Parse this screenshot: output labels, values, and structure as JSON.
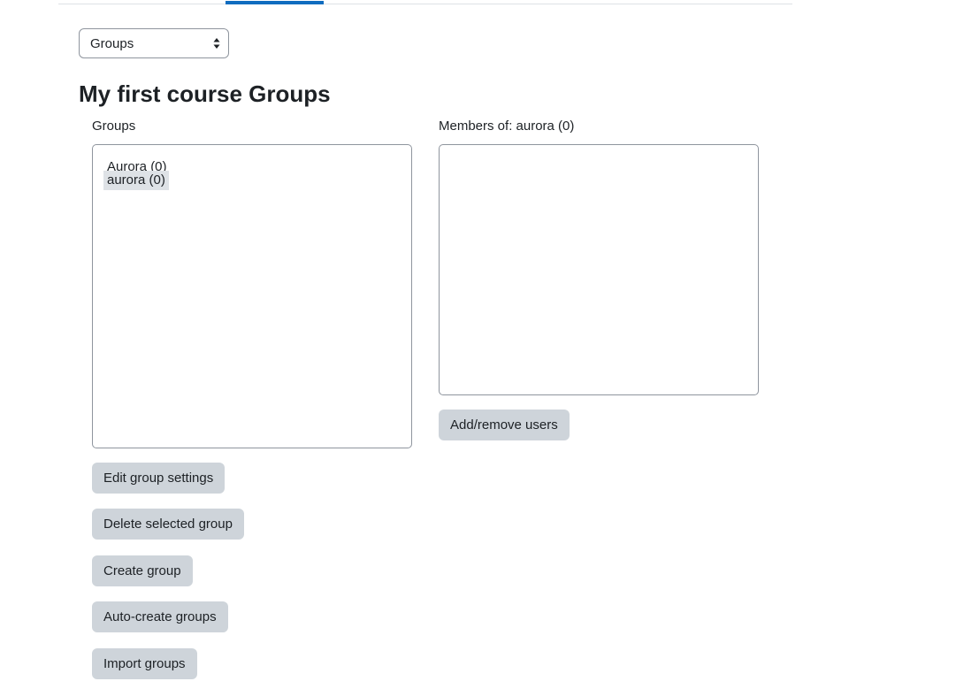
{
  "nav": {
    "active_tab_index": 1
  },
  "view_select": {
    "selected": "Groups"
  },
  "page": {
    "title": "My first course Groups"
  },
  "groups_panel": {
    "label": "Groups",
    "items": [
      {
        "label": "Aurora (0)",
        "selected": false
      },
      {
        "label": "aurora (0)",
        "selected": true
      }
    ],
    "buttons": {
      "edit": "Edit group settings",
      "delete": "Delete selected group",
      "create": "Create group",
      "auto_create": "Auto-create groups",
      "import": "Import groups"
    }
  },
  "members_panel": {
    "label": "Members of: aurora (0)",
    "items": [],
    "add_remove_button": "Add/remove users"
  },
  "colors": {
    "accent": "#0f6cbf",
    "button_bg": "#ced4da",
    "selected_bg": "#dee2e6"
  }
}
